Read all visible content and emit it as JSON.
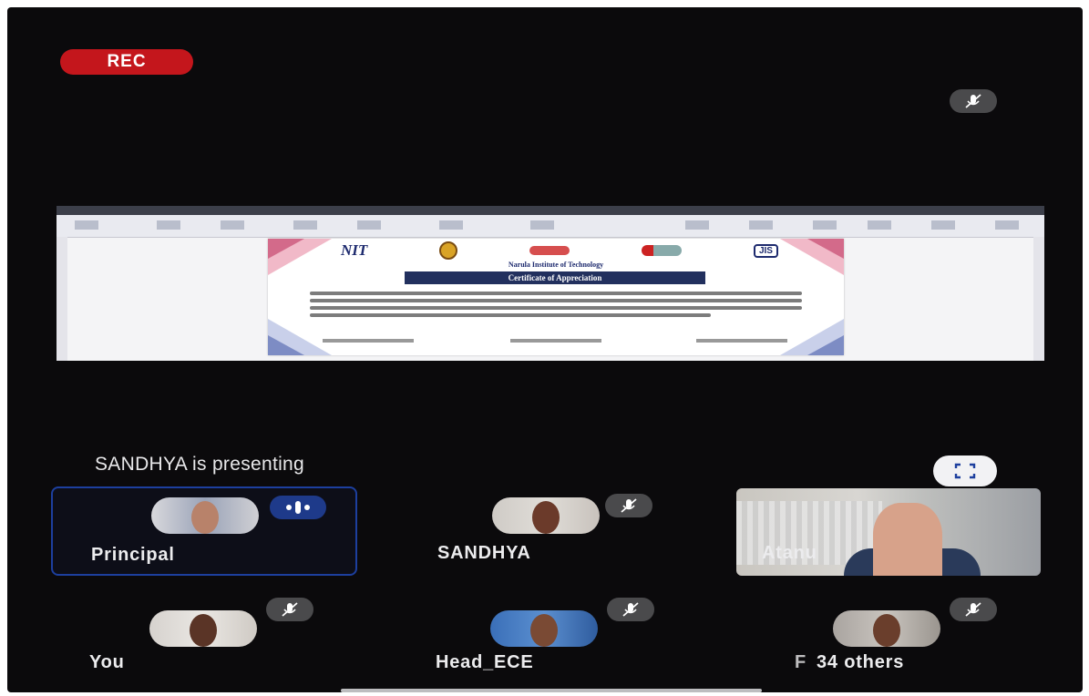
{
  "recording": {
    "label": "REC"
  },
  "share": {
    "institute_name": "Narula Institute of Technology",
    "certificate_title": "Certificate of Appreciation",
    "logo_text": "NIT",
    "logo_text_2": "JIS"
  },
  "presenting": {
    "text": "SANDHYA is presenting"
  },
  "participants": [
    {
      "name": "Principal",
      "state": "speaking"
    },
    {
      "name": "SANDHYA",
      "state": "muted"
    },
    {
      "name": "Atanu",
      "state": "video"
    },
    {
      "name": "You",
      "state": "muted"
    },
    {
      "name": "Head_ECE",
      "state": "muted"
    },
    {
      "name": "34 others",
      "prefix": "F",
      "state": "muted"
    }
  ],
  "icons": {
    "mute": "mic-off-icon",
    "speaking": "audio-level-icon",
    "fullscreen": "fullscreen-icon"
  },
  "colors": {
    "background": "#0b0a0c",
    "rec": "#c4161c",
    "active_border": "#1d3f9e",
    "speaking_pill": "#1e3a8a",
    "mute_pill": "#4a4a4c"
  }
}
